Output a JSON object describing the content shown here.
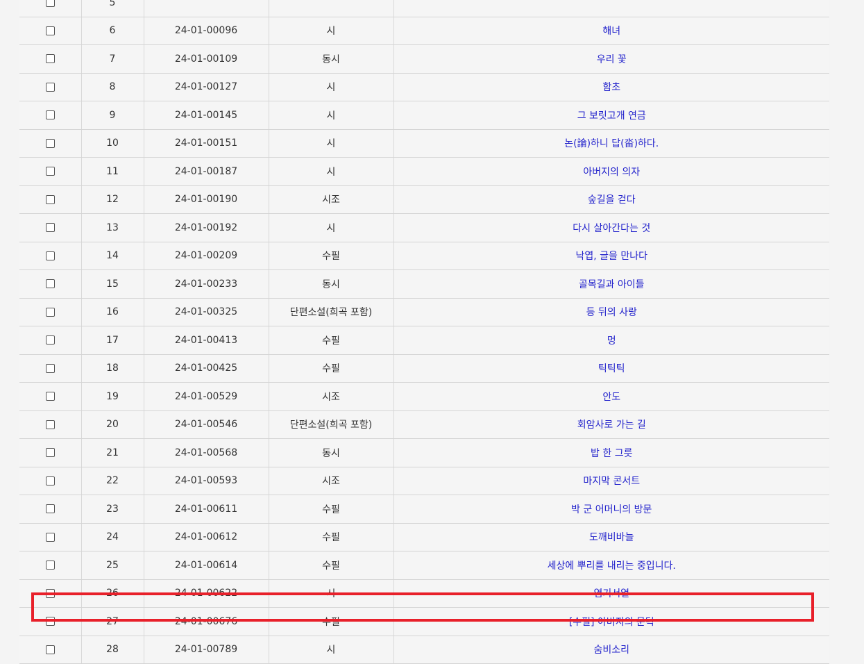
{
  "table": {
    "rows": [
      {
        "num": "5",
        "code": "",
        "genre": "",
        "title": ""
      },
      {
        "num": "6",
        "code": "24-01-00096",
        "genre": "시",
        "title": "해녀"
      },
      {
        "num": "7",
        "code": "24-01-00109",
        "genre": "동시",
        "title": "우리 꽃"
      },
      {
        "num": "8",
        "code": "24-01-00127",
        "genre": "시",
        "title": "함초"
      },
      {
        "num": "9",
        "code": "24-01-00145",
        "genre": "시",
        "title": "그 보릿고개 연금"
      },
      {
        "num": "10",
        "code": "24-01-00151",
        "genre": "시",
        "title": "논(論)하니 답(畓)하다."
      },
      {
        "num": "11",
        "code": "24-01-00187",
        "genre": "시",
        "title": "아버지의 의자"
      },
      {
        "num": "12",
        "code": "24-01-00190",
        "genre": "시조",
        "title": "숲길을 걷다"
      },
      {
        "num": "13",
        "code": "24-01-00192",
        "genre": "시",
        "title": "다시 살아간다는 것"
      },
      {
        "num": "14",
        "code": "24-01-00209",
        "genre": "수필",
        "title": "낙엽, 글을 만나다"
      },
      {
        "num": "15",
        "code": "24-01-00233",
        "genre": "동시",
        "title": "골목길과 아이들"
      },
      {
        "num": "16",
        "code": "24-01-00325",
        "genre": "단편소설(희곡 포함)",
        "title": "등 뒤의 사랑"
      },
      {
        "num": "17",
        "code": "24-01-00413",
        "genre": "수필",
        "title": "멍"
      },
      {
        "num": "18",
        "code": "24-01-00425",
        "genre": "수필",
        "title": "틱틱틱"
      },
      {
        "num": "19",
        "code": "24-01-00529",
        "genre": "시조",
        "title": "안도"
      },
      {
        "num": "20",
        "code": "24-01-00546",
        "genre": "단편소설(희곡 포함)",
        "title": "회암사로 가는 길"
      },
      {
        "num": "21",
        "code": "24-01-00568",
        "genre": "동시",
        "title": "밥 한 그릇"
      },
      {
        "num": "22",
        "code": "24-01-00593",
        "genre": "시조",
        "title": "마지막 콘서트"
      },
      {
        "num": "23",
        "code": "24-01-00611",
        "genre": "수필",
        "title": "박 군 어머니의 방문"
      },
      {
        "num": "24",
        "code": "24-01-00612",
        "genre": "수필",
        "title": "도깨비바늘"
      },
      {
        "num": "25",
        "code": "24-01-00614",
        "genre": "수필",
        "title": "세상에 뿌리를 내리는 중입니다."
      },
      {
        "num": "26",
        "code": "24-01-00622",
        "genre": "시",
        "title": "염기서열"
      },
      {
        "num": "27",
        "code": "24-01-00676",
        "genre": "수필",
        "title": "[수필] 아버지의 문턱"
      },
      {
        "num": "28",
        "code": "24-01-00789",
        "genre": "시",
        "title": "숨비소리"
      }
    ]
  },
  "highlight": {
    "row_num": "27",
    "color": "#e8202a"
  },
  "colors": {
    "link": "#2222cc",
    "text": "#333333",
    "row_bg": "#f5f5f5",
    "border": "#d4d4d4"
  }
}
